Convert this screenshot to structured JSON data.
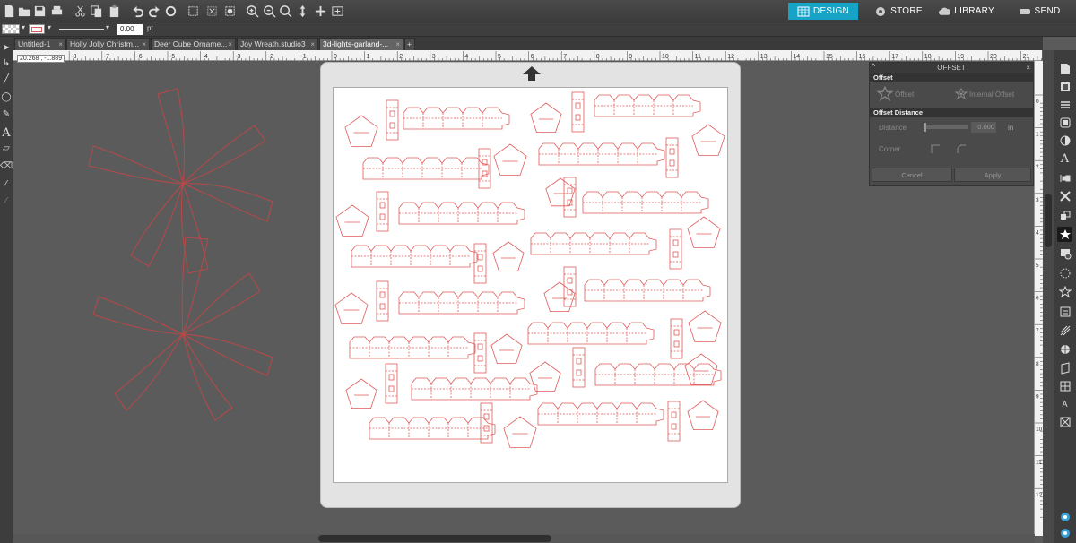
{
  "toolbar": {
    "nav": [
      {
        "label": "DESIGN",
        "icon": "grid-icon"
      },
      {
        "label": "STORE",
        "icon": "globe-icon"
      },
      {
        "label": "LIBRARY",
        "icon": "cloud-icon"
      },
      {
        "label": "SEND",
        "icon": "cutter-icon"
      }
    ],
    "accent": "#17a3c6"
  },
  "linebar": {
    "width_value": "0.00",
    "unit": "pt"
  },
  "tabs": [
    {
      "label": "Untitled-1"
    },
    {
      "label": "Holly Jolly Christm..."
    },
    {
      "label": "Deer Cube Orname..."
    },
    {
      "label": "Joy Wreath.studio3"
    },
    {
      "label": "3d-lights-garland-..."
    }
  ],
  "tab_add": "+",
  "tab_close": "×",
  "ruler": {
    "top_labels": [
      "8",
      "7",
      "6",
      "5",
      "4",
      "3",
      "2",
      "1",
      "0",
      "1",
      "2",
      "3",
      "4",
      "5",
      "6",
      "7",
      "8",
      "9",
      "10",
      "11",
      "12",
      "13",
      "14",
      "15",
      "16",
      "17",
      "18",
      "19",
      "20",
      "21"
    ],
    "top_neg": [
      "-8",
      "-7",
      "-6",
      "-5",
      "-4",
      "-3",
      "-2",
      "-1"
    ],
    "right_labels": [
      "0",
      "1",
      "2",
      "3",
      "4",
      "5",
      "6",
      "7",
      "8",
      "9",
      "10",
      "11",
      "12"
    ],
    "coords": "20.268 , -1.889"
  },
  "offset_panel": {
    "title": "OFFSET",
    "section1": "Offset",
    "offset_label": "Offset",
    "internal_label": "Internal Offset",
    "section2": "Offset Distance",
    "distance_label": "Distance",
    "distance_value": "0.000",
    "distance_unit": "in",
    "corner_label": "Corner",
    "cancel": "Cancel",
    "apply": "Apply"
  },
  "colors": {
    "cut_line": "#e05a5a",
    "mat": "#e3e3e3"
  }
}
